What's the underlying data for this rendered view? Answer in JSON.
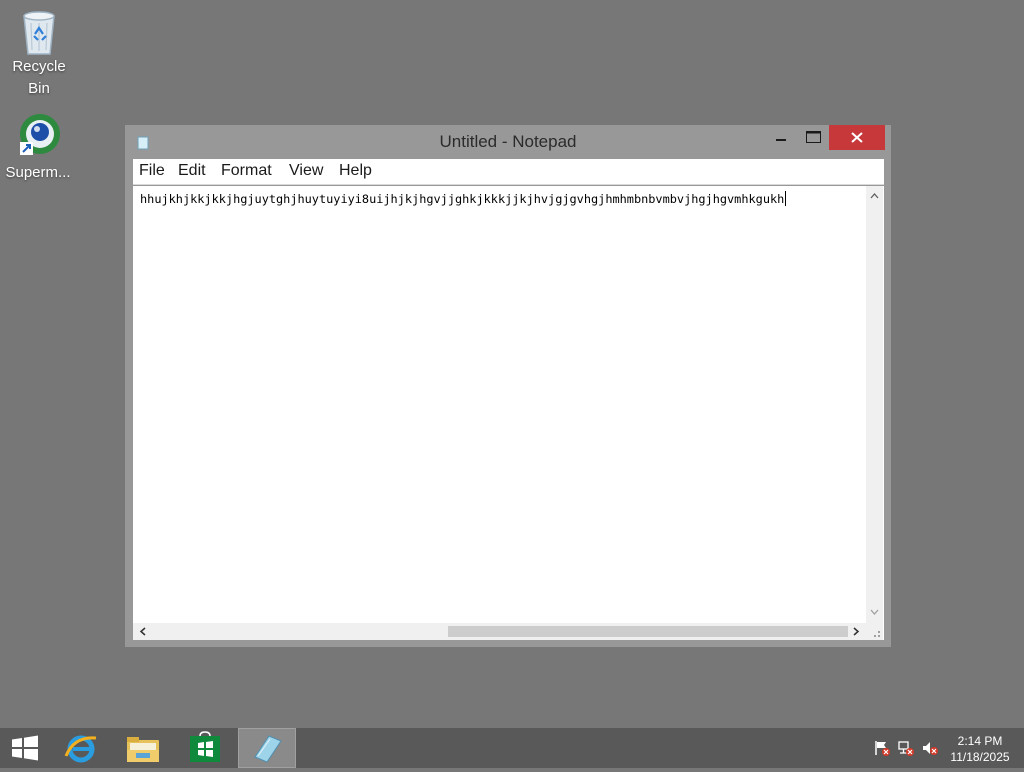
{
  "desktop": {
    "icons": [
      {
        "label": "Recycle Bin"
      },
      {
        "label": "Superm..."
      }
    ]
  },
  "notepad": {
    "title": "Untitled - Notepad",
    "menu": [
      "File",
      "Edit",
      "Format",
      "View",
      "Help"
    ],
    "content": "hhujkhjkkjkkjhgjuytghjhuytuyiyi8uijhjkjhgvjjghkjkkkjjkjhvjgjgvhgjhmhmbnbvmbvjhgjhgvmhkgukh",
    "close_color": "#c7383a"
  },
  "taskbar": {
    "apps": [
      "start-icon",
      "internet-explorer-icon",
      "file-explorer-icon",
      "store-icon",
      "notepad-icon"
    ],
    "time": "2:14 PM",
    "date": "11/18/2025"
  }
}
